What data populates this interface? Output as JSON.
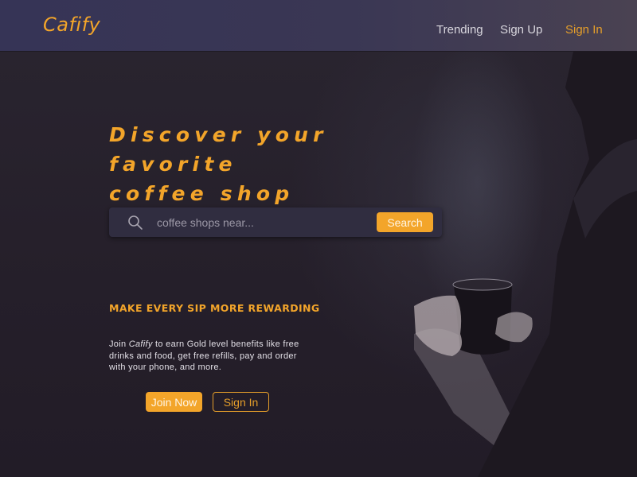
{
  "header": {
    "logo": "Cafify",
    "nav": [
      {
        "label": "Trending"
      },
      {
        "label": "Sign Up"
      },
      {
        "label": "Sign In"
      }
    ]
  },
  "hero": {
    "headline_line1": "Discover your favorite",
    "headline_line2": "coffee shop"
  },
  "search": {
    "placeholder": "coffee shops near...",
    "value": "",
    "button_label": "Search",
    "icon": "search-icon"
  },
  "rewards": {
    "title": "MAKE EVERY SIP MORE REWARDING",
    "body_prefix": "Join ",
    "body_brand": "Cafify",
    "body_suffix": " to earn Gold level benefits like free drinks and food, get free refills, pay and order with your phone, and more.",
    "join_label": "Join Now",
    "signin_label": "Sign In"
  },
  "colors": {
    "accent": "#f3a52a",
    "header_bg": "#363456",
    "page_bg": "#241e29",
    "search_bg": "#302d40"
  }
}
